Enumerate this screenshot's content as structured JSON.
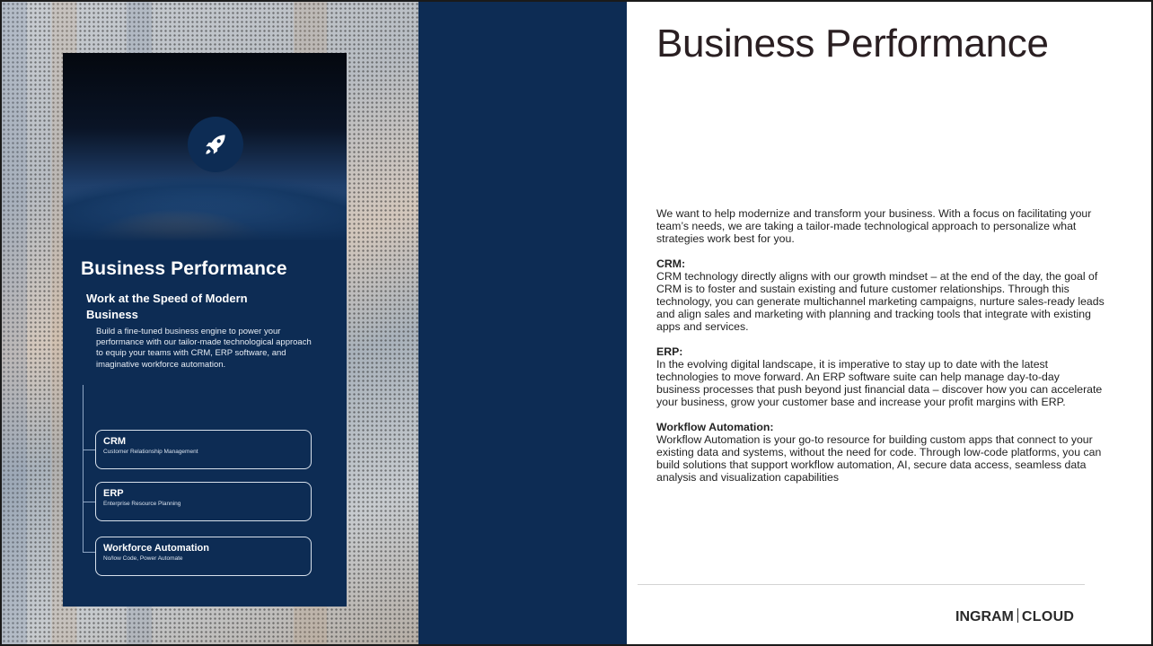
{
  "brochure": {
    "title": "Business Performance",
    "subtitle": "Work at the Speed of Modern Business",
    "body": "Build a fine-tuned business engine to power your performance with our tailor-made technological approach to equip your teams with CRM, ERP software, and imaginative workforce automation.",
    "items": [
      {
        "title": "CRM",
        "subtitle": "Customer Relationship Management"
      },
      {
        "title": "ERP",
        "subtitle": "Enterprise Resource Planning"
      },
      {
        "title": "Workforce Automation",
        "subtitle": "No/low Code, Power Automate"
      }
    ],
    "icon": "rocket-icon"
  },
  "content": {
    "title": "Business Performance",
    "intro": "We want to help modernize and transform your business. With a focus on facilitating your team’s needs, we are taking a tailor-made technological approach to personalize what strategies work best for you.",
    "sections": [
      {
        "heading": "CRM:",
        "text": "CRM technology directly aligns with our growth mindset – at the end of the day, the goal of CRM is to foster and sustain existing and future customer relationships. Through this technology, you can generate multichannel marketing campaigns, nurture sales-ready leads and align sales and marketing with planning and tracking tools that integrate with existing apps and services."
      },
      {
        "heading": "ERP:",
        "text": "In the evolving digital landscape, it is imperative to stay up to date with the latest technologies to move forward. An ERP software suite can help manage day-to-day business processes that push beyond just financial data – discover how you can accelerate your business, grow your customer base and increase your profit margins with ERP."
      },
      {
        "heading": "Workflow Automation:",
        "text": "Workflow Automation is your go-to resource for building custom apps that connect to your existing data and systems, without the need for code. Through low-code platforms, you can build solutions that support workflow automation, AI, secure data access, seamless data analysis and visualization capabilities"
      }
    ]
  },
  "footer": {
    "logo_left": "INGRAM",
    "logo_right": "CLOUD"
  },
  "colors": {
    "navy": "#0d2c54",
    "title_text": "#2a1f22"
  }
}
